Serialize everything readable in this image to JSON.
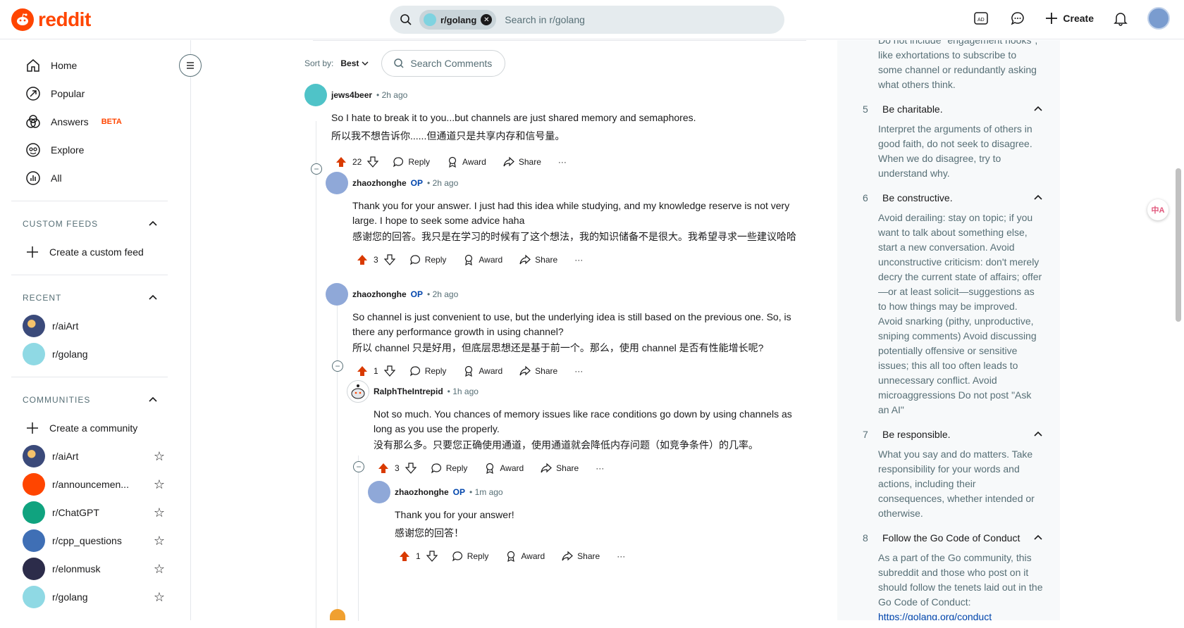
{
  "header": {
    "logo_text": "reddit",
    "search_chip": "r/golang",
    "search_placeholder": "Search in r/golang",
    "create_label": "Create"
  },
  "sidebar": {
    "nav": [
      {
        "label": "Home",
        "icon": "home-icon"
      },
      {
        "label": "Popular",
        "icon": "popular-icon"
      },
      {
        "label": "Answers",
        "icon": "answers-icon",
        "badge": "BETA"
      },
      {
        "label": "Explore",
        "icon": "explore-icon"
      },
      {
        "label": "All",
        "icon": "all-icon"
      }
    ],
    "custom_feeds": {
      "title": "CUSTOM FEEDS",
      "create_label": "Create a custom feed"
    },
    "recent": {
      "title": "RECENT",
      "items": [
        "r/aiArt",
        "r/golang"
      ]
    },
    "communities": {
      "title": "COMMUNITIES",
      "create_label": "Create a community",
      "items": [
        "r/aiArt",
        "r/announcemen...",
        "r/ChatGPT",
        "r/cpp_questions",
        "r/elonmusk",
        "r/golang"
      ]
    }
  },
  "sort": {
    "label": "Sort by:",
    "value": "Best",
    "search_placeholder": "Search Comments"
  },
  "actions": {
    "reply": "Reply",
    "award": "Award",
    "share": "Share",
    "more": "···"
  },
  "comments": [
    {
      "author": "jews4beer",
      "op": "",
      "time": "2h ago",
      "lines": [
        "So I hate to break it to you...but channels are just shared memory and semaphores.",
        "所以我不想告诉你......但通道只是共享内存和信号量。"
      ],
      "votes": "22"
    },
    {
      "author": "zhaozhonghe",
      "op": "OP",
      "time": "2h ago",
      "lines": [
        "Thank you for your answer. I just had this idea while studying, and my knowledge reserve is not very large. I hope to seek some advice haha",
        "感谢您的回答。我只是在学习的时候有了这个想法，我的知识储备不是很大。我希望寻求一些建议哈哈"
      ],
      "votes": "3"
    },
    {
      "author": "zhaozhonghe",
      "op": "OP",
      "time": "2h ago",
      "lines": [
        "So channel is just convenient to use, but the underlying idea is still based on the previous one. So, is there any performance growth in using channel?",
        "所以 channel 只是好用，但底层思想还是基于前一个。那么，使用 channel 是否有性能增长呢?"
      ],
      "votes": "1"
    },
    {
      "author": "RalphTheIntrepid",
      "op": "",
      "time": "1h ago",
      "lines": [
        "Not so much. You chances of memory issues like race conditions go down by using channels as long as you use the properly.",
        "没有那么多。只要您正确使用通道，使用通道就会降低内存问题（如竞争条件）的几率。"
      ],
      "votes": "3"
    },
    {
      "author": "zhaozhonghe",
      "op": "OP",
      "time": "1m ago",
      "lines": [
        "Thank you for your answer!",
        "感谢您的回答！"
      ],
      "votes": "1"
    }
  ],
  "rules": {
    "top_text": "Do not include \"engagement hooks\", like exhortations to subscribe to some channel or redundantly asking what others think.",
    "items": [
      {
        "num": "5",
        "title": "Be charitable.",
        "text": "Interpret the arguments of others in good faith, do not seek to disagree. When we do disagree, try to understand why."
      },
      {
        "num": "6",
        "title": "Be constructive.",
        "text": "Avoid derailing: stay on topic; if you want to talk about something else, start a new conversation. Avoid unconstructive criticism: don't merely decry the current state of affairs; offer—or at least solicit—suggestions as to how things may be improved. Avoid snarking (pithy, unproductive, sniping comments) Avoid discussing potentially offensive or sensitive issues; this all too often leads to unnecessary conflict. Avoid microaggressions Do not post \"Ask an AI\""
      },
      {
        "num": "7",
        "title": "Be responsible.",
        "text": "What you say and do matters. Take responsibility for your words and actions, including their consequences, whether intended or otherwise."
      },
      {
        "num": "8",
        "title": "Follow the Go Code of Conduct",
        "text": "As a part of the Go community, this subreddit and those who post on it should follow the tenets laid out in the Go Code of Conduct:"
      }
    ],
    "link": "https://golang.org/conduct"
  },
  "colors": {
    "brand": "#ff4500",
    "op": "#0045ac",
    "upvote": "#d93a00"
  }
}
